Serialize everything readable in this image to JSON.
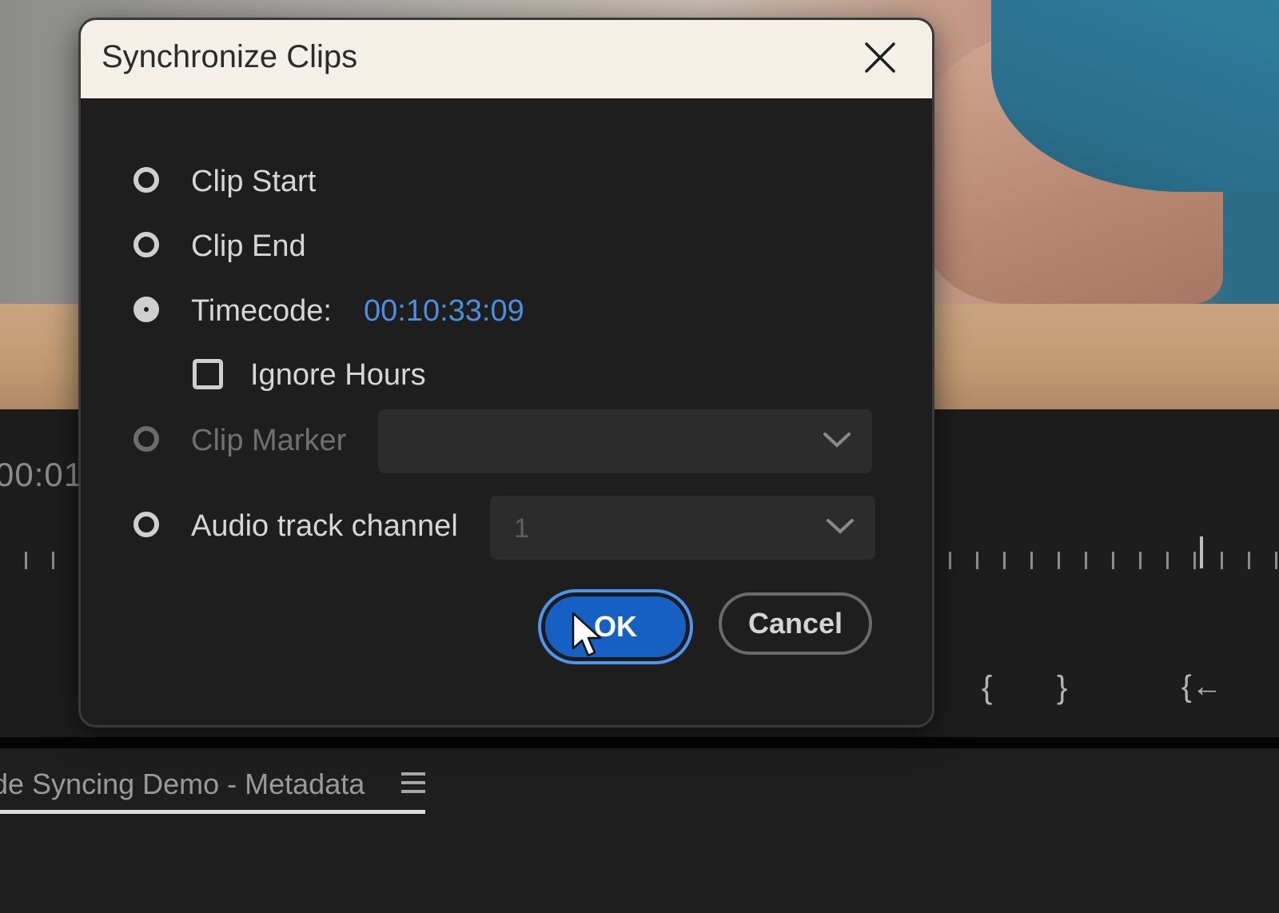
{
  "dialog": {
    "title": "Synchronize Clips",
    "options": {
      "clip_start": "Clip Start",
      "clip_end": "Clip End",
      "timecode": "Timecode:",
      "timecode_value": "00:10:33:09",
      "ignore_hours": "Ignore Hours",
      "clip_marker": "Clip Marker",
      "clip_marker_value": "",
      "audio_track_channel": "Audio track channel",
      "audio_track_channel_value": "1"
    },
    "selected_option": "timecode",
    "ignore_hours_checked": false,
    "ok_label": "OK",
    "cancel_label": "Cancel"
  },
  "background": {
    "timecode_partial": "00:01",
    "metadata_tab": "de Syncing Demo - Metadata"
  },
  "colors": {
    "accent_blue": "#1660C4",
    "timecode_blue": "#4C8FE0",
    "titlebar": "#F4F0E8",
    "dialog_bg": "#1E1E1E"
  }
}
